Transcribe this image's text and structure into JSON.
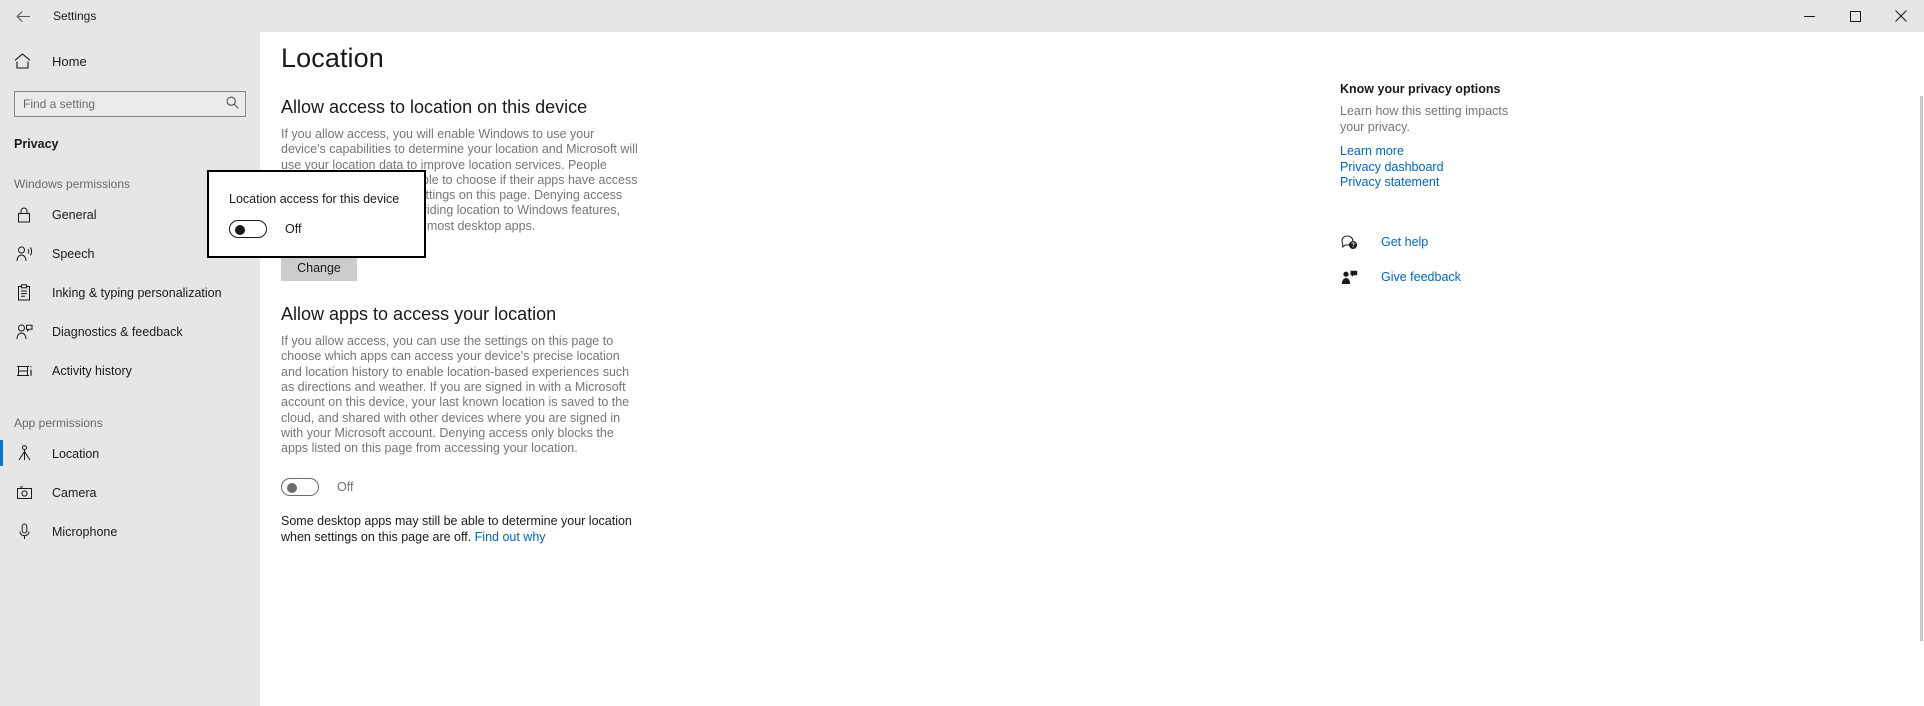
{
  "titlebar": {
    "back_icon": "arrow-left-icon",
    "title": "Settings",
    "minimize_icon": "minimize-icon",
    "maximize_icon": "maximize-icon",
    "close_icon": "close-icon"
  },
  "sidebar": {
    "home": {
      "label": "Home",
      "icon": "home-icon"
    },
    "search": {
      "placeholder": "Find a setting",
      "value": "",
      "icon": "search-icon"
    },
    "section_title": "Privacy",
    "groups": [
      {
        "header": "Windows permissions",
        "items": [
          {
            "label": "General",
            "icon": "lock-icon",
            "selected": false
          },
          {
            "label": "Speech",
            "icon": "speech-icon",
            "selected": false
          },
          {
            "label": "Inking & typing personalization",
            "icon": "clipboard-pen-icon",
            "selected": false
          },
          {
            "label": "Diagnostics & feedback",
            "icon": "person-feedback-icon",
            "selected": false
          },
          {
            "label": "Activity history",
            "icon": "activity-history-icon",
            "selected": false
          }
        ]
      },
      {
        "header": "App permissions",
        "items": [
          {
            "label": "Location",
            "icon": "location-pin-icon",
            "selected": true
          },
          {
            "label": "Camera",
            "icon": "camera-icon",
            "selected": false
          },
          {
            "label": "Microphone",
            "icon": "microphone-icon",
            "selected": false
          }
        ]
      }
    ]
  },
  "main": {
    "page_title": "Location",
    "section1": {
      "heading": "Allow access to location on this device",
      "body": "If you allow access, you will enable Windows to use your device's capabilities to determine your location and Microsoft will use your location data to improve location services. People using this device will be able to choose if their apps have access to location by using the settings on this page. Denying access blocks Windows from providing location to Windows features, Microsoft Store apps, and most desktop apps.",
      "change_button": "Change"
    },
    "section2": {
      "heading": "Allow apps to access your location",
      "body": "If you allow access, you can use the settings on this page to choose which apps can access your device's precise location and location history to enable location-based experiences such as directions and weather. If you are signed in with a Microsoft account on this device, your last known location is saved to the cloud, and shared with other devices where you are signed in with your Microsoft account. Denying access only blocks the apps listed on this page from accessing your location.",
      "toggle_state": "Off",
      "note_prefix": "Some desktop apps may still be able to determine your location when settings on this page are off. ",
      "note_link": "Find out why"
    }
  },
  "popup": {
    "title": "Location access for this device",
    "toggle_state": "Off"
  },
  "right_panel": {
    "title": "Know your privacy options",
    "text": "Learn how this setting impacts your privacy.",
    "links": [
      "Learn more",
      "Privacy dashboard",
      "Privacy statement"
    ],
    "actions": [
      {
        "label": "Get help",
        "icon": "help-icon"
      },
      {
        "label": "Give feedback",
        "icon": "feedback-icon"
      }
    ]
  },
  "colors": {
    "accent": "#0078d7",
    "link": "#0067c0",
    "sidebar_bg": "#e6e6e6",
    "body_text": "#767676"
  }
}
